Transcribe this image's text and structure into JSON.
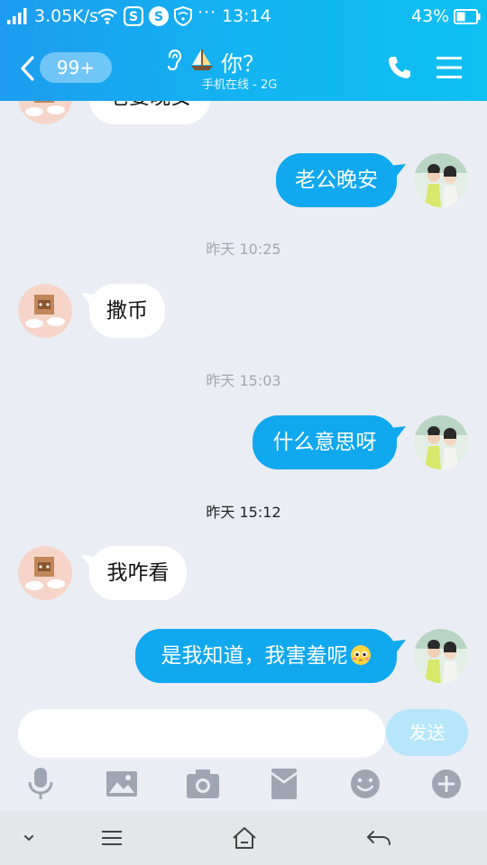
{
  "status_bar": {
    "net_speed": "3.05K/s",
    "time": "13:14",
    "battery": "43%",
    "more": "···"
  },
  "header": {
    "unread_badge": "99+",
    "contact_name": "你？",
    "contact_status": "手机在线 - 2G"
  },
  "messages": [
    {
      "side": "left",
      "text": "老婆晚安",
      "partial": true
    },
    {
      "side": "right",
      "text": "老公晚安"
    },
    {
      "type": "time",
      "text": "昨天 10:25"
    },
    {
      "side": "left",
      "text": "撒币"
    },
    {
      "type": "time",
      "text": "昨天 15:03"
    },
    {
      "side": "right",
      "text": "什么意思呀"
    },
    {
      "type": "time",
      "text": "昨天 15:12",
      "emphasis": true
    },
    {
      "side": "left",
      "text": "我咋看"
    },
    {
      "side": "right",
      "text": "是我知道，我害羞呢",
      "emoji": "shy-face-emoji"
    }
  ],
  "composer": {
    "input_value": "",
    "send_label": "发送"
  },
  "colors": {
    "header_start": "#1d9cf0",
    "header_end": "#0fc0f3",
    "bubble_self": "#10a8ee",
    "bubble_other": "#ffffff",
    "chat_bg": "#eaedf4",
    "send_disabled": "#b7e6fb"
  },
  "icons": {
    "status": [
      "signal-icon",
      "wifi-icon",
      "sogou-icon",
      "sync-icon",
      "vpn-shield-icon",
      "battery-icon"
    ],
    "header": [
      "back-icon",
      "ear-icon",
      "sailboat-icon",
      "phone-icon",
      "menu-icon"
    ],
    "toolbar": [
      "microphone-icon",
      "image-icon",
      "camera-icon",
      "red-packet-icon",
      "emoji-icon",
      "plus-icon"
    ],
    "system": [
      "chevron-down-icon",
      "hamburger-icon",
      "home-icon",
      "back-arrow-icon"
    ]
  }
}
